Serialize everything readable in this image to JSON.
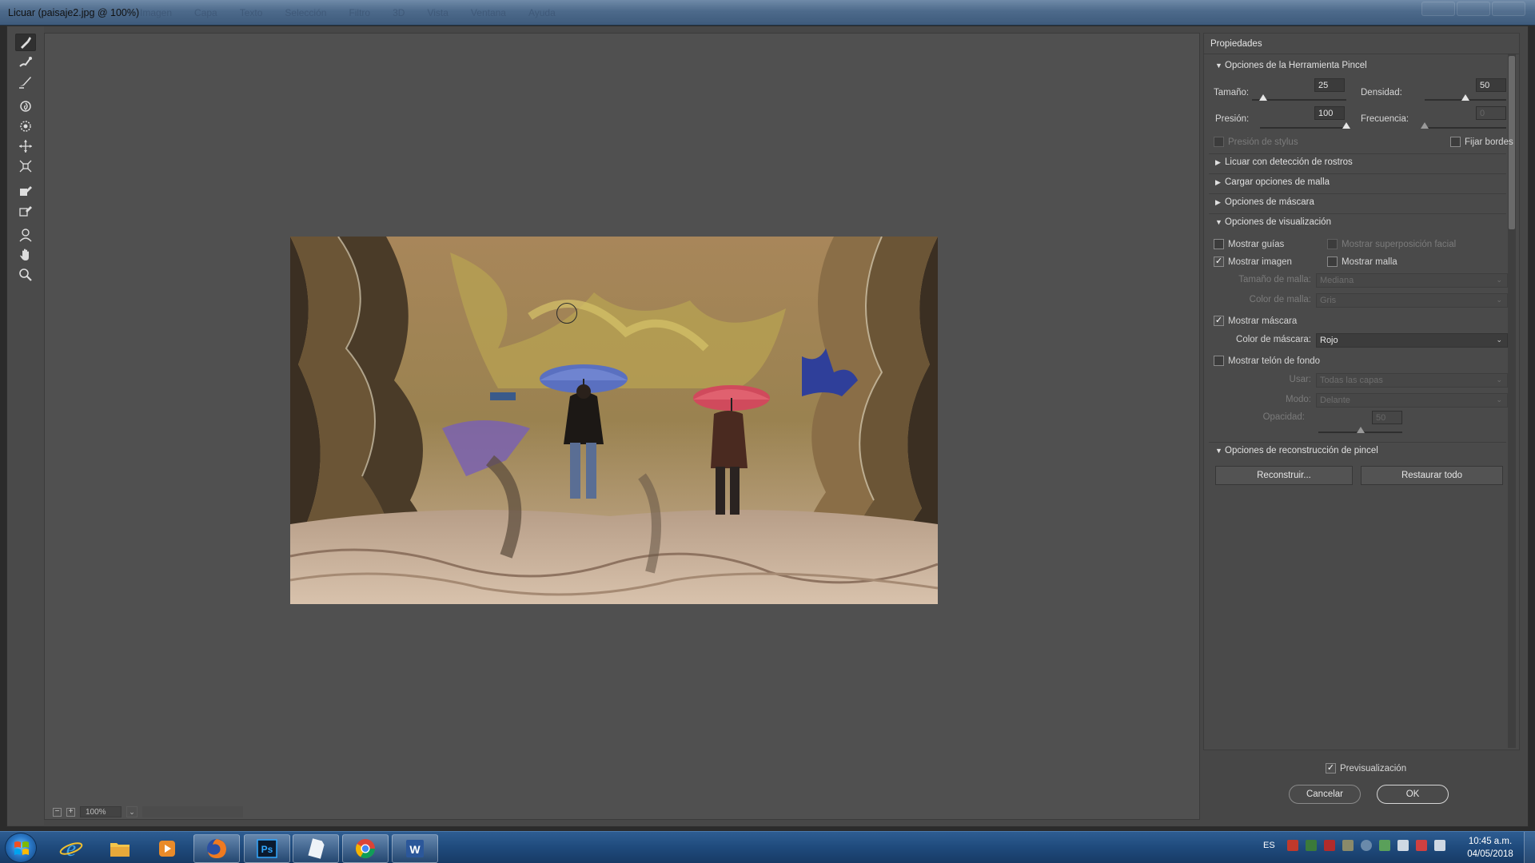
{
  "window": {
    "title": "Licuar (paisaje2.jpg @ 100%)",
    "ghost_menu": [
      "Imagen",
      "Capa",
      "Texto",
      "Selección",
      "Filtro",
      "3D",
      "Vista",
      "Ventana",
      "Ayuda"
    ]
  },
  "toolbar": {
    "tools": [
      {
        "name": "forward-warp-tool-icon",
        "active": true
      },
      {
        "name": "reconstruct-tool-icon"
      },
      {
        "name": "smooth-tool-icon"
      },
      {
        "name": "twirl-clockwise-tool-icon"
      },
      {
        "name": "pucker-tool-icon"
      },
      {
        "name": "bloat-tool-icon"
      },
      {
        "name": "push-left-tool-icon"
      },
      {
        "name": "freeze-mask-tool-icon"
      },
      {
        "name": "thaw-mask-tool-icon"
      },
      {
        "name": "face-tool-icon"
      },
      {
        "name": "hand-tool-icon"
      },
      {
        "name": "zoom-tool-icon"
      }
    ]
  },
  "canvas": {
    "zoom_minus": "−",
    "zoom_plus": "+",
    "zoom_value": "100%",
    "zoom_chevron": "⌄"
  },
  "panel": {
    "header": "Propiedades",
    "brush_section": "Opciones de la Herramienta Pincel",
    "size_label": "Tamaño:",
    "size_value": "25",
    "size_level": 0.12,
    "density_label": "Densidad:",
    "density_value": "50",
    "density_level": 0.5,
    "pressure_label": "Presión:",
    "pressure_value": "100",
    "pressure_level": 1.0,
    "rate_label": "Frecuencia:",
    "rate_value": "0",
    "rate_level": 0.0,
    "stylus_label": "Presión de stylus",
    "pin_edges_label": "Fijar bordes",
    "face_section": "Licuar con detección de rostros",
    "mesh_section": "Cargar opciones de malla",
    "mask_section": "Opciones de máscara",
    "view_section": "Opciones de visualización",
    "show_guides": "Mostrar guías",
    "show_face_overlay": "Mostrar superposición facial",
    "show_image": "Mostrar imagen",
    "show_mesh": "Mostrar malla",
    "mesh_size_label": "Tamaño de malla:",
    "mesh_size_value": "Mediana",
    "mesh_color_label": "Color de malla:",
    "mesh_color_value": "Gris",
    "show_mask": "Mostrar máscara",
    "mask_color_label": "Color de máscara:",
    "mask_color_value": "Rojo",
    "show_backdrop": "Mostrar telón de fondo",
    "use_label": "Usar:",
    "use_value": "Todas las capas",
    "mode_label": "Modo:",
    "mode_value": "Delante",
    "opacity_label": "Opacidad:",
    "opacity_value": "50",
    "opacity_level": 0.5,
    "reconstruct_section": "Opciones de reconstrucción de pincel",
    "reconstruct_button": "Reconstruir...",
    "restore_all_button": "Restaurar todo",
    "preview_label": "Previsualización",
    "cancel_button": "Cancelar",
    "ok_button": "OK",
    "check_mark": "✓",
    "triangle_open": "▼",
    "triangle_closed": "▶",
    "select_arrow": "⌄"
  },
  "taskbar": {
    "language": "ES",
    "time": "10:45 a.m.",
    "date": "04/05/2018",
    "apps": [
      "windows-start-icon",
      "internet-explorer-icon",
      "file-explorer-icon",
      "media-player-icon",
      "firefox-icon",
      "photoshop-icon",
      "blank-document-icon",
      "chrome-icon",
      "word-icon"
    ],
    "photoshop_letters": "Ps",
    "word_letter": "W"
  }
}
